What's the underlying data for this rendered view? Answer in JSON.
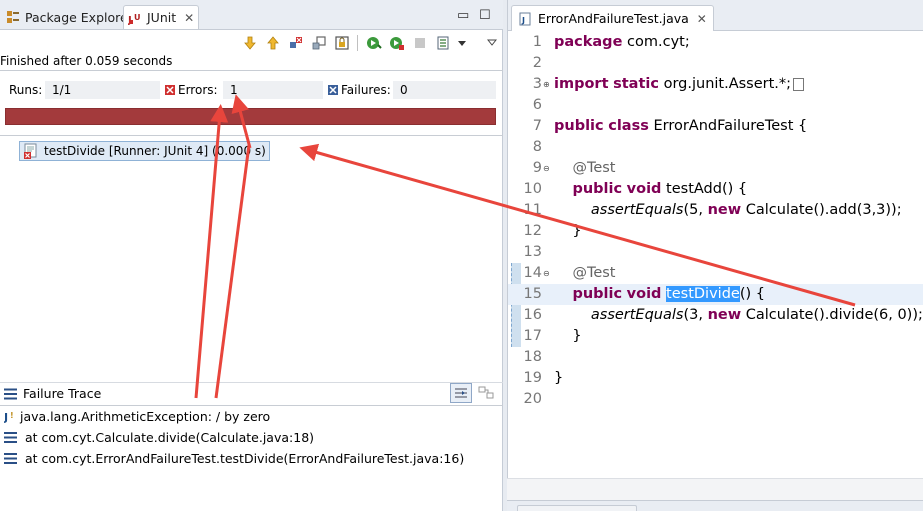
{
  "left": {
    "tabs": [
      {
        "label": "Package Explorer"
      },
      {
        "label": "JUnit",
        "close": "✕"
      }
    ],
    "window_controls": {
      "minimize": "▭",
      "maximize": "☐"
    },
    "status": "Finished after 0.059 seconds",
    "counts": {
      "runs_label": "Runs:",
      "runs_value": "1/1",
      "errors_label": "Errors:",
      "errors_value": "1",
      "failures_label": "Failures:",
      "failures_value": "0"
    },
    "progress_color": "#a33a3c",
    "tree": [
      {
        "label": "testDivide [Runner: JUnit 4] (0.000 s)",
        "icon": "test-error-icon"
      }
    ],
    "failure_trace": {
      "title": "Failure Trace",
      "lines": [
        {
          "text": "java.lang.ArithmeticException: / by zero",
          "icon": "exception-icon"
        },
        {
          "text": "at com.cyt.Calculate.divide(Calculate.java:18)",
          "icon": "stack-frame-icon"
        },
        {
          "text": "at com.cyt.ErrorAndFailureTest.testDivide(ErrorAndFailureTest.java:16)",
          "icon": "stack-frame-icon"
        }
      ]
    }
  },
  "editor": {
    "tab": {
      "label": "ErrorAndFailureTest.java",
      "close": "✕"
    },
    "lines": [
      {
        "n": "1",
        "code": [
          {
            "t": "package",
            "k": "kw"
          },
          {
            "t": " com.cyt;"
          }
        ]
      },
      {
        "n": "2",
        "code": []
      },
      {
        "n": "3",
        "fold": "⊕",
        "code": [
          {
            "t": "import",
            "k": "kw"
          },
          {
            "t": " "
          },
          {
            "t": "static",
            "k": "kw"
          },
          {
            "t": " org.junit.Assert.*;"
          }
        ],
        "boxed": true
      },
      {
        "n": "6",
        "code": []
      },
      {
        "n": "7",
        "code": [
          {
            "t": "public",
            "k": "kw"
          },
          {
            "t": " "
          },
          {
            "t": "class",
            "k": "kw"
          },
          {
            "t": " ErrorAndFailureTest {"
          }
        ]
      },
      {
        "n": "8",
        "code": []
      },
      {
        "n": "9",
        "fold": "⊖",
        "code": [
          {
            "t": "    "
          },
          {
            "t": "@Test",
            "k": "an"
          }
        ]
      },
      {
        "n": "10",
        "code": [
          {
            "t": "    "
          },
          {
            "t": "public",
            "k": "kw"
          },
          {
            "t": " "
          },
          {
            "t": "void",
            "k": "kw"
          },
          {
            "t": " testAdd() {"
          }
        ]
      },
      {
        "n": "11",
        "code": [
          {
            "t": "        "
          },
          {
            "t": "assertEquals",
            "k": "it"
          },
          {
            "t": "(5, "
          },
          {
            "t": "new",
            "k": "kw"
          },
          {
            "t": " Calculate().add(3,3));"
          }
        ]
      },
      {
        "n": "12",
        "code": [
          {
            "t": "    }"
          }
        ]
      },
      {
        "n": "13",
        "code": []
      },
      {
        "n": "14",
        "fold": "⊖",
        "code": [
          {
            "t": "    "
          },
          {
            "t": "@Test",
            "k": "an"
          }
        ]
      },
      {
        "n": "15",
        "current": true,
        "code": [
          {
            "t": "    "
          },
          {
            "t": "public",
            "k": "kw"
          },
          {
            "t": " "
          },
          {
            "t": "void",
            "k": "kw"
          },
          {
            "t": " "
          },
          {
            "t": "testDivide",
            "k": "sel"
          },
          {
            "t": "() {"
          }
        ]
      },
      {
        "n": "16",
        "code": [
          {
            "t": "        "
          },
          {
            "t": "assertEquals",
            "k": "it"
          },
          {
            "t": "(3, "
          },
          {
            "t": "new",
            "k": "kw"
          },
          {
            "t": " Calculate().divide(6, 0));"
          }
        ]
      },
      {
        "n": "17",
        "code": [
          {
            "t": "    }"
          }
        ]
      },
      {
        "n": "18",
        "code": []
      },
      {
        "n": "19",
        "code": [
          {
            "t": "}"
          }
        ]
      },
      {
        "n": "20",
        "code": []
      }
    ]
  }
}
